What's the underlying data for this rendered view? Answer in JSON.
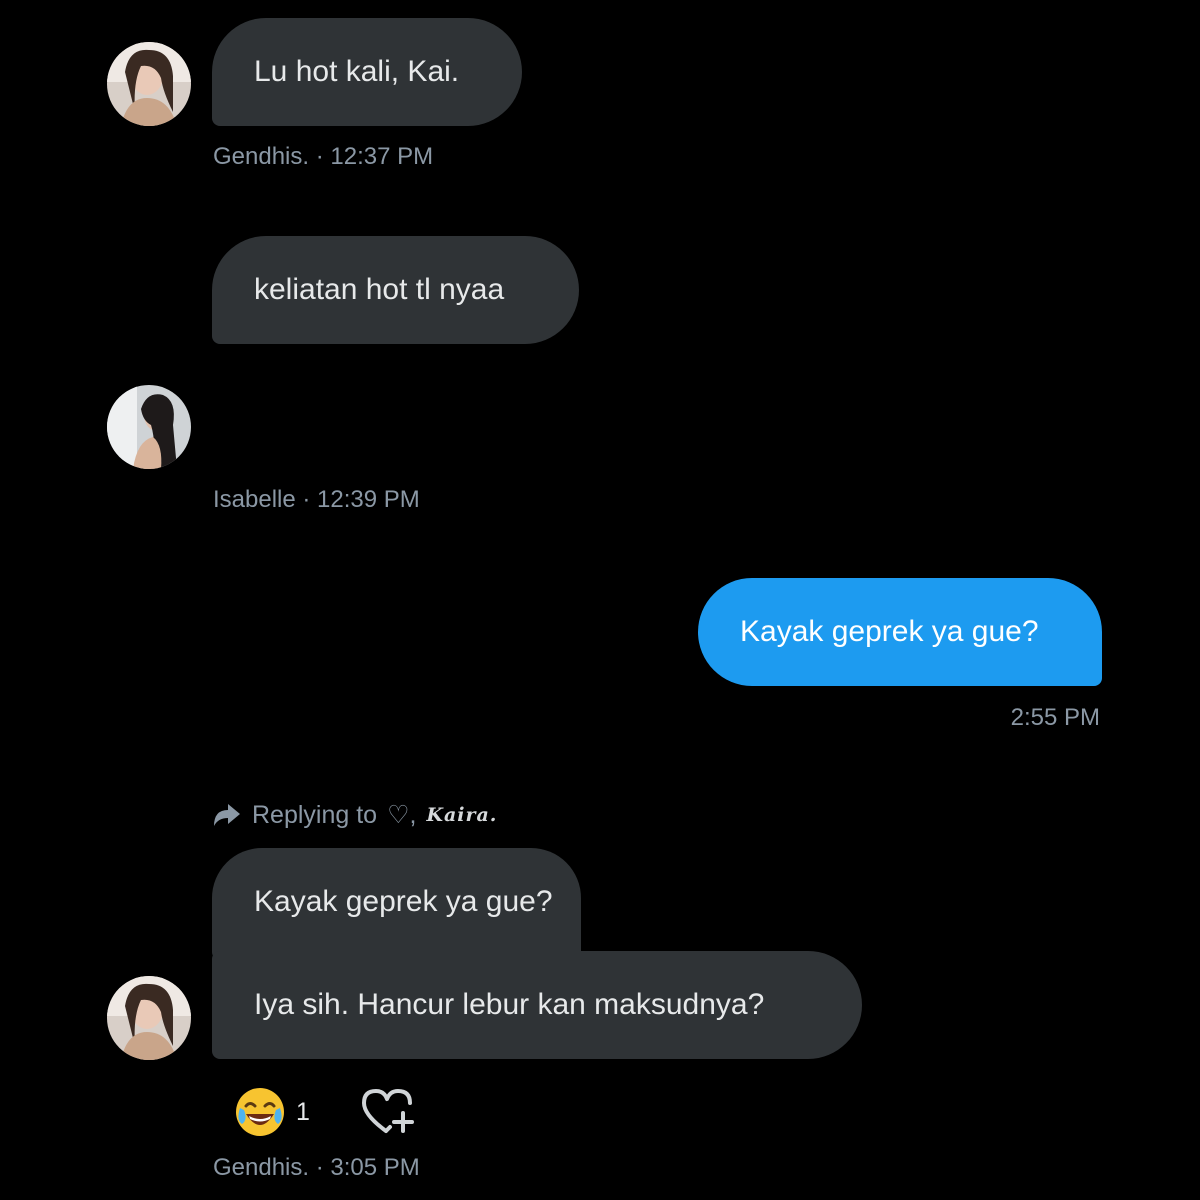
{
  "messages": [
    {
      "sender": "Gendhis.",
      "time": "12:37 PM",
      "bubbles": [
        "Lu hot kali, Kai.",
        "keliatan hot tl nyaa"
      ],
      "meta": "Gendhis. · 12:37 PM"
    },
    {
      "sender": "Isabelle",
      "time": "12:39 PM",
      "meta": "Isabelle · 12:39 PM"
    },
    {
      "sender": "self",
      "text": "Kayak geprek ya gue?",
      "meta": "2:55 PM"
    },
    {
      "sender": "Gendhis.",
      "replying_prefix": "Replying to",
      "replying_name_prefix": "♡,",
      "replying_name": "Kaira.",
      "quoted_text": "Kayak geprek ya gue?",
      "text": "Iya sih. Hancur lebur kan maksudnya?",
      "reaction_count": "1",
      "meta": "Gendhis. · 3:05 PM"
    }
  ],
  "icons": {
    "reply_arrow": "reply-arrow-icon",
    "reaction_emoji": "tears-of-joy-emoji",
    "add_reaction": "heart-plus-icon"
  },
  "colors": {
    "background": "#000000",
    "incoming_bubble": "#2f3336",
    "outgoing_bubble": "#1d9bf0",
    "meta_text": "#8b98a5"
  }
}
